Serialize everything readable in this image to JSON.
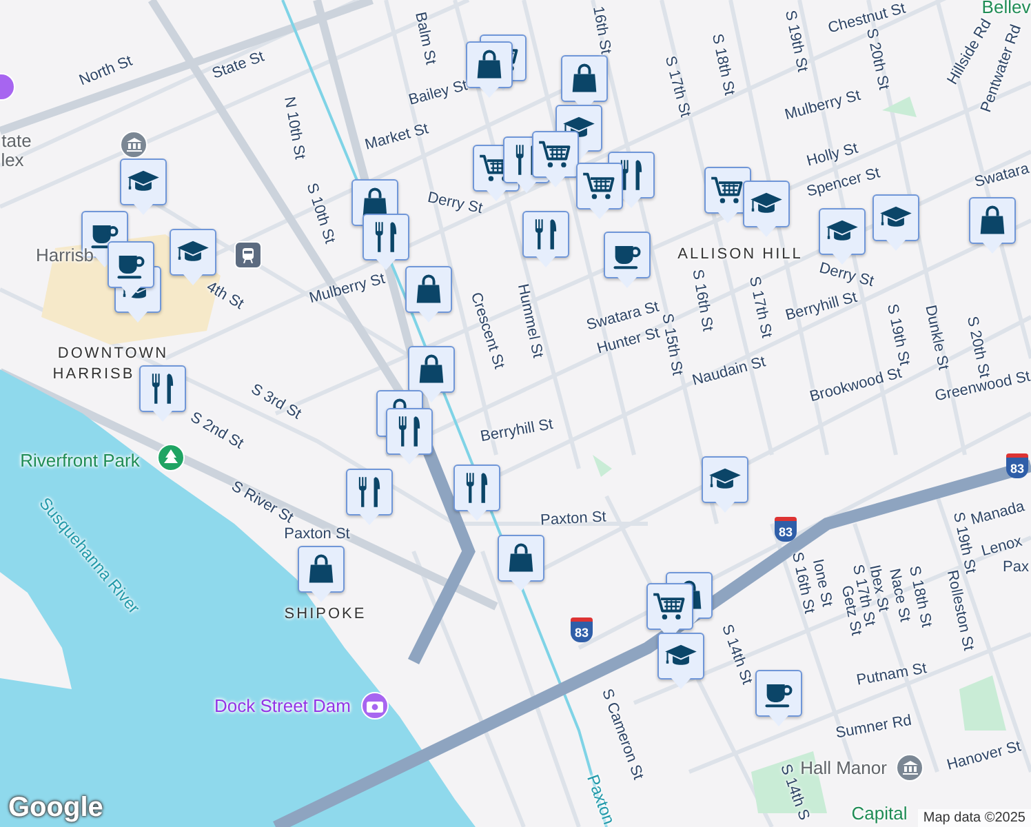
{
  "map": {
    "labels": [
      {
        "text": "North St",
        "kind": "street"
      },
      {
        "text": "State St",
        "kind": "street"
      },
      {
        "text": "Balm St",
        "kind": "street"
      },
      {
        "text": "N 10th St",
        "kind": "street"
      },
      {
        "text": "Market St",
        "kind": "street"
      },
      {
        "text": "Bailey St",
        "kind": "street"
      },
      {
        "text": "S 10th St",
        "kind": "street"
      },
      {
        "text": "Derry St",
        "kind": "street"
      },
      {
        "text": "Mulberry St",
        "kind": "street"
      },
      {
        "text": "Crescent St",
        "kind": "street"
      },
      {
        "text": "Hummel St",
        "kind": "street"
      },
      {
        "text": "16th St",
        "kind": "street"
      },
      {
        "text": "Chestnut St",
        "kind": "street"
      },
      {
        "text": "S 17th St",
        "kind": "street"
      },
      {
        "text": "S 18th St",
        "kind": "street"
      },
      {
        "text": "S 19th St",
        "kind": "street"
      },
      {
        "text": "S 20th St",
        "kind": "street"
      },
      {
        "text": "Hillside Rd",
        "kind": "street"
      },
      {
        "text": "Pentwater Rd",
        "kind": "street"
      },
      {
        "text": "Mulberry St",
        "kind": "street"
      },
      {
        "text": "Holly St",
        "kind": "street"
      },
      {
        "text": "Spencer St",
        "kind": "street"
      },
      {
        "text": "Swatara",
        "kind": "street"
      },
      {
        "text": "ALLISON HILL",
        "kind": "district"
      },
      {
        "text": "Derry St",
        "kind": "street"
      },
      {
        "text": "Berryhill St",
        "kind": "street"
      },
      {
        "text": "Swatara St",
        "kind": "street"
      },
      {
        "text": "Hunter St",
        "kind": "street"
      },
      {
        "text": "S 15th St",
        "kind": "street"
      },
      {
        "text": "S 16th St",
        "kind": "street"
      },
      {
        "text": "S 17th St",
        "kind": "street"
      },
      {
        "text": "Naudain St",
        "kind": "street"
      },
      {
        "text": "Brookwood St",
        "kind": "street"
      },
      {
        "text": "S 19th St",
        "kind": "street"
      },
      {
        "text": "Dunkle St",
        "kind": "street"
      },
      {
        "text": "S 20th St",
        "kind": "street"
      },
      {
        "text": "Greenwood St",
        "kind": "street"
      },
      {
        "text": "Berryhill St",
        "kind": "street"
      },
      {
        "text": "S 3rd St",
        "kind": "street"
      },
      {
        "text": "S 2nd St",
        "kind": "street"
      },
      {
        "text": "Riverfront Park",
        "kind": "park"
      },
      {
        "text": "S River St",
        "kind": "street"
      },
      {
        "text": "Paxton St",
        "kind": "street"
      },
      {
        "text": "SHIPOKE",
        "kind": "district"
      },
      {
        "text": "Susquehanna River",
        "kind": "water"
      },
      {
        "text": "Dock Street Dam",
        "kind": "landmark"
      },
      {
        "text": "Paxton St",
        "kind": "street"
      },
      {
        "text": "S Cameron St",
        "kind": "street"
      },
      {
        "text": "S 14th St",
        "kind": "street"
      },
      {
        "text": "Putnam St",
        "kind": "street"
      },
      {
        "text": "Sumner Rd",
        "kind": "street"
      },
      {
        "text": "Hall Manor",
        "kind": "poi"
      },
      {
        "text": "Hanover St",
        "kind": "street"
      },
      {
        "text": "S 16th St",
        "kind": "street"
      },
      {
        "text": "Ione St",
        "kind": "street"
      },
      {
        "text": "S 17th St",
        "kind": "street"
      },
      {
        "text": "Getz St",
        "kind": "street"
      },
      {
        "text": "Ibex St",
        "kind": "street"
      },
      {
        "text": "Nace St",
        "kind": "street"
      },
      {
        "text": "S 18th St",
        "kind": "street"
      },
      {
        "text": "Rolleston St",
        "kind": "street"
      },
      {
        "text": "S 19th St",
        "kind": "street"
      },
      {
        "text": "Manada",
        "kind": "street"
      },
      {
        "text": "Lenox",
        "kind": "street"
      },
      {
        "text": "Pax",
        "kind": "street"
      },
      {
        "text": "tate",
        "kind": "poi"
      },
      {
        "text": "lex",
        "kind": "poi"
      },
      {
        "text": "Harrisb",
        "kind": "poi"
      },
      {
        "text": "DOWNTOWN",
        "kind": "district"
      },
      {
        "text": "HARRISB",
        "kind": "district"
      },
      {
        "text": "4th St",
        "kind": "street"
      },
      {
        "text": "S 14th S",
        "kind": "street"
      },
      {
        "text": "Capital",
        "kind": "park"
      },
      {
        "text": "Paxton",
        "kind": "water"
      },
      {
        "text": "Bellev",
        "kind": "park"
      }
    ],
    "shields": [
      {
        "text": "83"
      },
      {
        "text": "83"
      },
      {
        "text": "83"
      }
    ],
    "markers": [
      {
        "kind": "grocery"
      },
      {
        "kind": "shopping"
      },
      {
        "kind": "shopping"
      },
      {
        "kind": "school"
      },
      {
        "kind": "grocery"
      },
      {
        "kind": "restaurant"
      },
      {
        "kind": "grocery"
      },
      {
        "kind": "restaurant"
      },
      {
        "kind": "grocery"
      },
      {
        "kind": "grocery"
      },
      {
        "kind": "school"
      },
      {
        "kind": "school"
      },
      {
        "kind": "school"
      },
      {
        "kind": "shopping"
      },
      {
        "kind": "restaurant"
      },
      {
        "kind": "cafe"
      },
      {
        "kind": "school"
      },
      {
        "kind": "cafe"
      },
      {
        "kind": "school"
      },
      {
        "kind": "school"
      },
      {
        "kind": "cafe"
      },
      {
        "kind": "restaurant"
      },
      {
        "kind": "shopping"
      },
      {
        "kind": "restaurant"
      },
      {
        "kind": "shopping"
      },
      {
        "kind": "shopping"
      },
      {
        "kind": "shopping"
      },
      {
        "kind": "restaurant"
      },
      {
        "kind": "restaurant"
      },
      {
        "kind": "restaurant"
      },
      {
        "kind": "shopping"
      },
      {
        "kind": "shopping"
      },
      {
        "kind": "school"
      },
      {
        "kind": "shopping"
      },
      {
        "kind": "grocery"
      },
      {
        "kind": "school"
      },
      {
        "kind": "cafe"
      }
    ],
    "logo": "Google",
    "attribution": "Map data ©2025"
  }
}
